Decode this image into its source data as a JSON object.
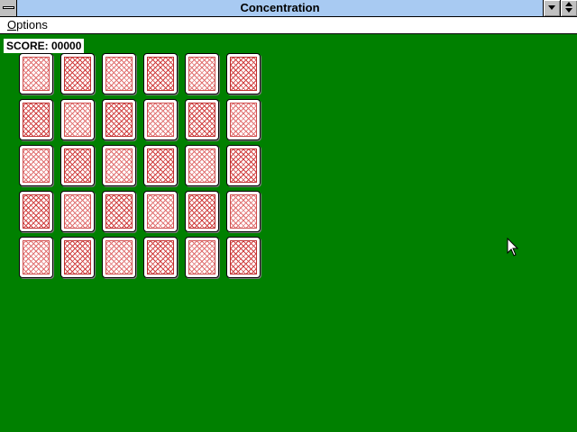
{
  "window": {
    "title": "Concentration"
  },
  "menubar": {
    "options_label": "ptions",
    "options_mnemonic": "O"
  },
  "game": {
    "score_label": "SCORE: 00000",
    "grid": {
      "rows": 5,
      "cols": 6
    },
    "cards": [
      [
        "face-down",
        "face-down",
        "face-down",
        "face-down",
        "face-down",
        "face-down"
      ],
      [
        "face-down",
        "face-down",
        "face-down",
        "face-down",
        "face-down",
        "face-down"
      ],
      [
        "face-down",
        "face-down",
        "face-down",
        "face-down",
        "face-down",
        "face-down"
      ],
      [
        "face-down",
        "face-down",
        "face-down",
        "face-down",
        "face-down",
        "face-down"
      ],
      [
        "face-down",
        "face-down",
        "face-down",
        "face-down",
        "face-down",
        "face-down"
      ]
    ]
  },
  "colors": {
    "felt": "#008000",
    "titlebar": "#a8caf2",
    "card_back": "#d04040"
  },
  "icons": {
    "system_menu": "system-menu-icon",
    "minimize": "minimize-icon",
    "maximize": "restore-icon",
    "cursor": "mouse-pointer-icon"
  }
}
